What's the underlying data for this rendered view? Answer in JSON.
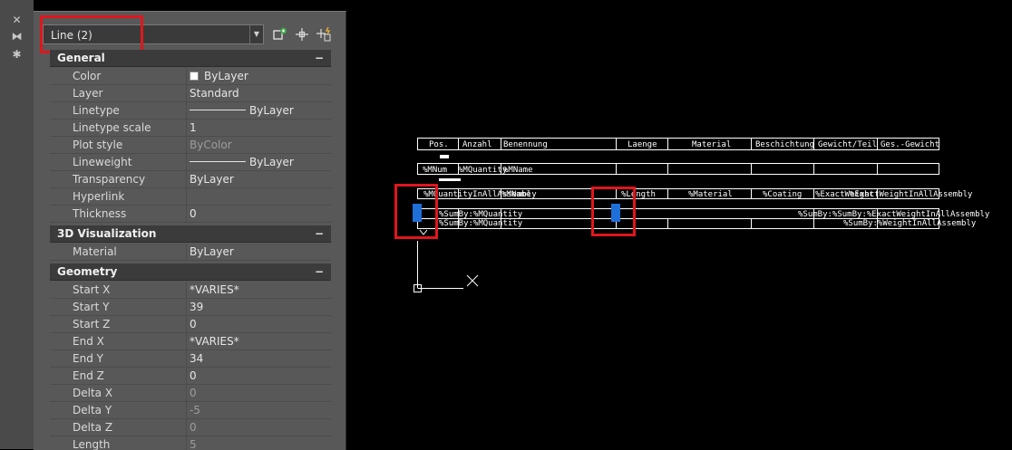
{
  "window": {
    "close_glyph": "✕",
    "pin_glyph": "⧓",
    "settings_glyph": "✱"
  },
  "selector": {
    "value": "Line (2)",
    "icons": [
      "quick-select-icon",
      "select-objects-icon",
      "toggle-pickadd-icon"
    ]
  },
  "sections": {
    "general": {
      "title": "General",
      "collapse": "−",
      "rows": [
        {
          "name": "Color",
          "value": "ByLayer"
        },
        {
          "name": "Layer",
          "value": "Standard"
        },
        {
          "name": "Linetype",
          "value": "ByLayer"
        },
        {
          "name": "Linetype scale",
          "value": "1"
        },
        {
          "name": "Plot style",
          "value": "ByColor"
        },
        {
          "name": "Lineweight",
          "value": "ByLayer"
        },
        {
          "name": "Transparency",
          "value": "ByLayer"
        },
        {
          "name": "Hyperlink",
          "value": ""
        },
        {
          "name": "Thickness",
          "value": "0"
        }
      ]
    },
    "visualization": {
      "title": "3D Visualization",
      "collapse": "−",
      "rows": [
        {
          "name": "Material",
          "value": "ByLayer"
        }
      ]
    },
    "geometry": {
      "title": "Geometry",
      "collapse": "−",
      "rows": [
        {
          "name": "Start X",
          "value": "*VARIES*"
        },
        {
          "name": "Start Y",
          "value": "39"
        },
        {
          "name": "Start Z",
          "value": "0"
        },
        {
          "name": "End X",
          "value": "*VARIES*"
        },
        {
          "name": "End Y",
          "value": "34"
        },
        {
          "name": "End Z",
          "value": "0"
        },
        {
          "name": "Delta X",
          "value": "0"
        },
        {
          "name": "Delta Y",
          "value": "-5"
        },
        {
          "name": "Delta Z",
          "value": "0"
        },
        {
          "name": "Length",
          "value": "5"
        }
      ]
    }
  },
  "drawing": {
    "headers": [
      "Pos.",
      "Anzahl",
      "Benennung",
      "Laenge",
      "Material",
      "Beschichtung",
      "Gewicht/Teil",
      "Ges.-Gewicht"
    ],
    "row1": [
      "%MNum",
      "%MQuantity",
      "%MName"
    ],
    "row2": [
      "%MQuantityInAllAssembly",
      "%MName",
      "%Length",
      "%Material",
      "%Coating",
      "%ExactWeight",
      "%ExactWeightInAllAssembly"
    ],
    "row3": [
      "%SumBy:%MQuantity",
      "%SumBy:%SumBy:%ExactWeightInAllAssembly"
    ],
    "row4": [
      "%SumBy:%MQuantity",
      "%SumBy:%WeightInAllAssembly"
    ]
  },
  "colors": {
    "highlight": "#e0161d",
    "grip": "#1f6fd8",
    "panel": "#585858",
    "section": "#3b3b3b"
  }
}
